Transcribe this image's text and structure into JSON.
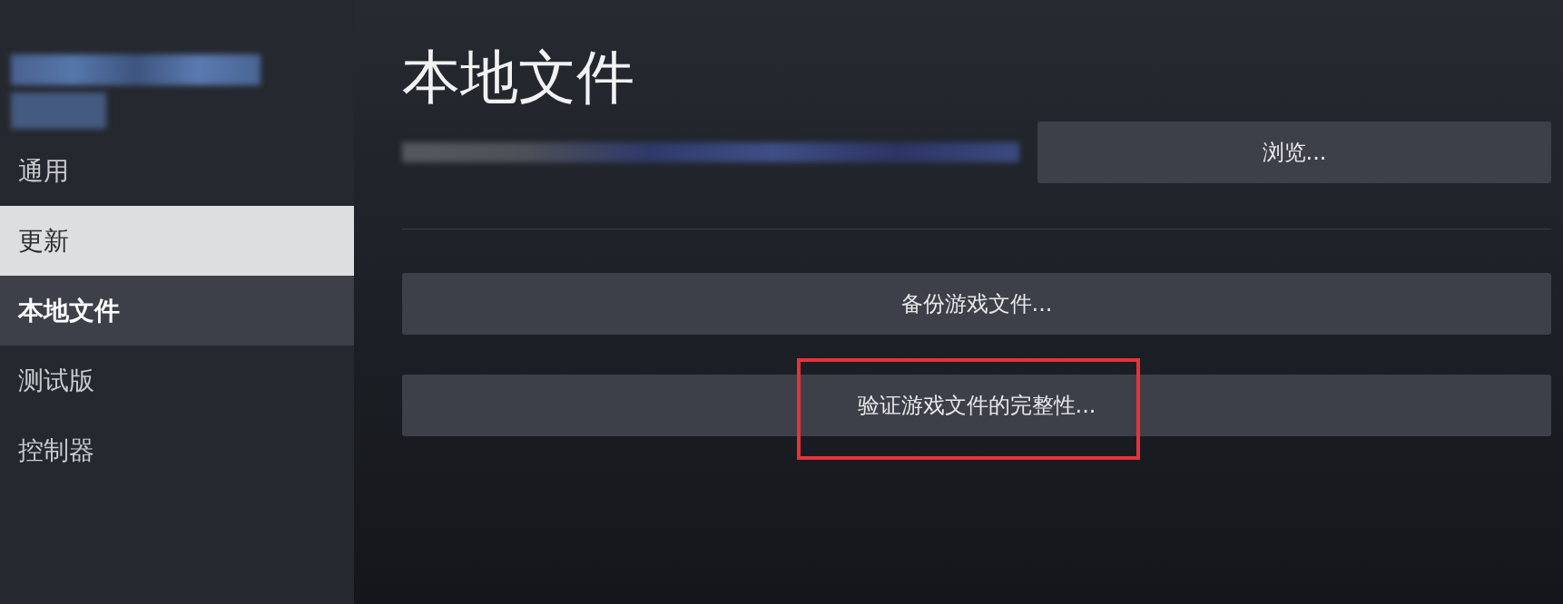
{
  "sidebar": {
    "items": [
      {
        "label": "通用",
        "selected": false,
        "hover": false
      },
      {
        "label": "更新",
        "selected": false,
        "hover": true
      },
      {
        "label": "本地文件",
        "selected": true,
        "hover": false
      },
      {
        "label": "测试版",
        "selected": false,
        "hover": false
      },
      {
        "label": "控制器",
        "selected": false,
        "hover": false
      }
    ]
  },
  "main": {
    "title": "本地文件",
    "browse_button": "浏览...",
    "buttons": [
      {
        "label": "备份游戏文件...",
        "highlighted": false
      },
      {
        "label": "验证游戏文件的完整性...",
        "highlighted": true
      }
    ]
  }
}
